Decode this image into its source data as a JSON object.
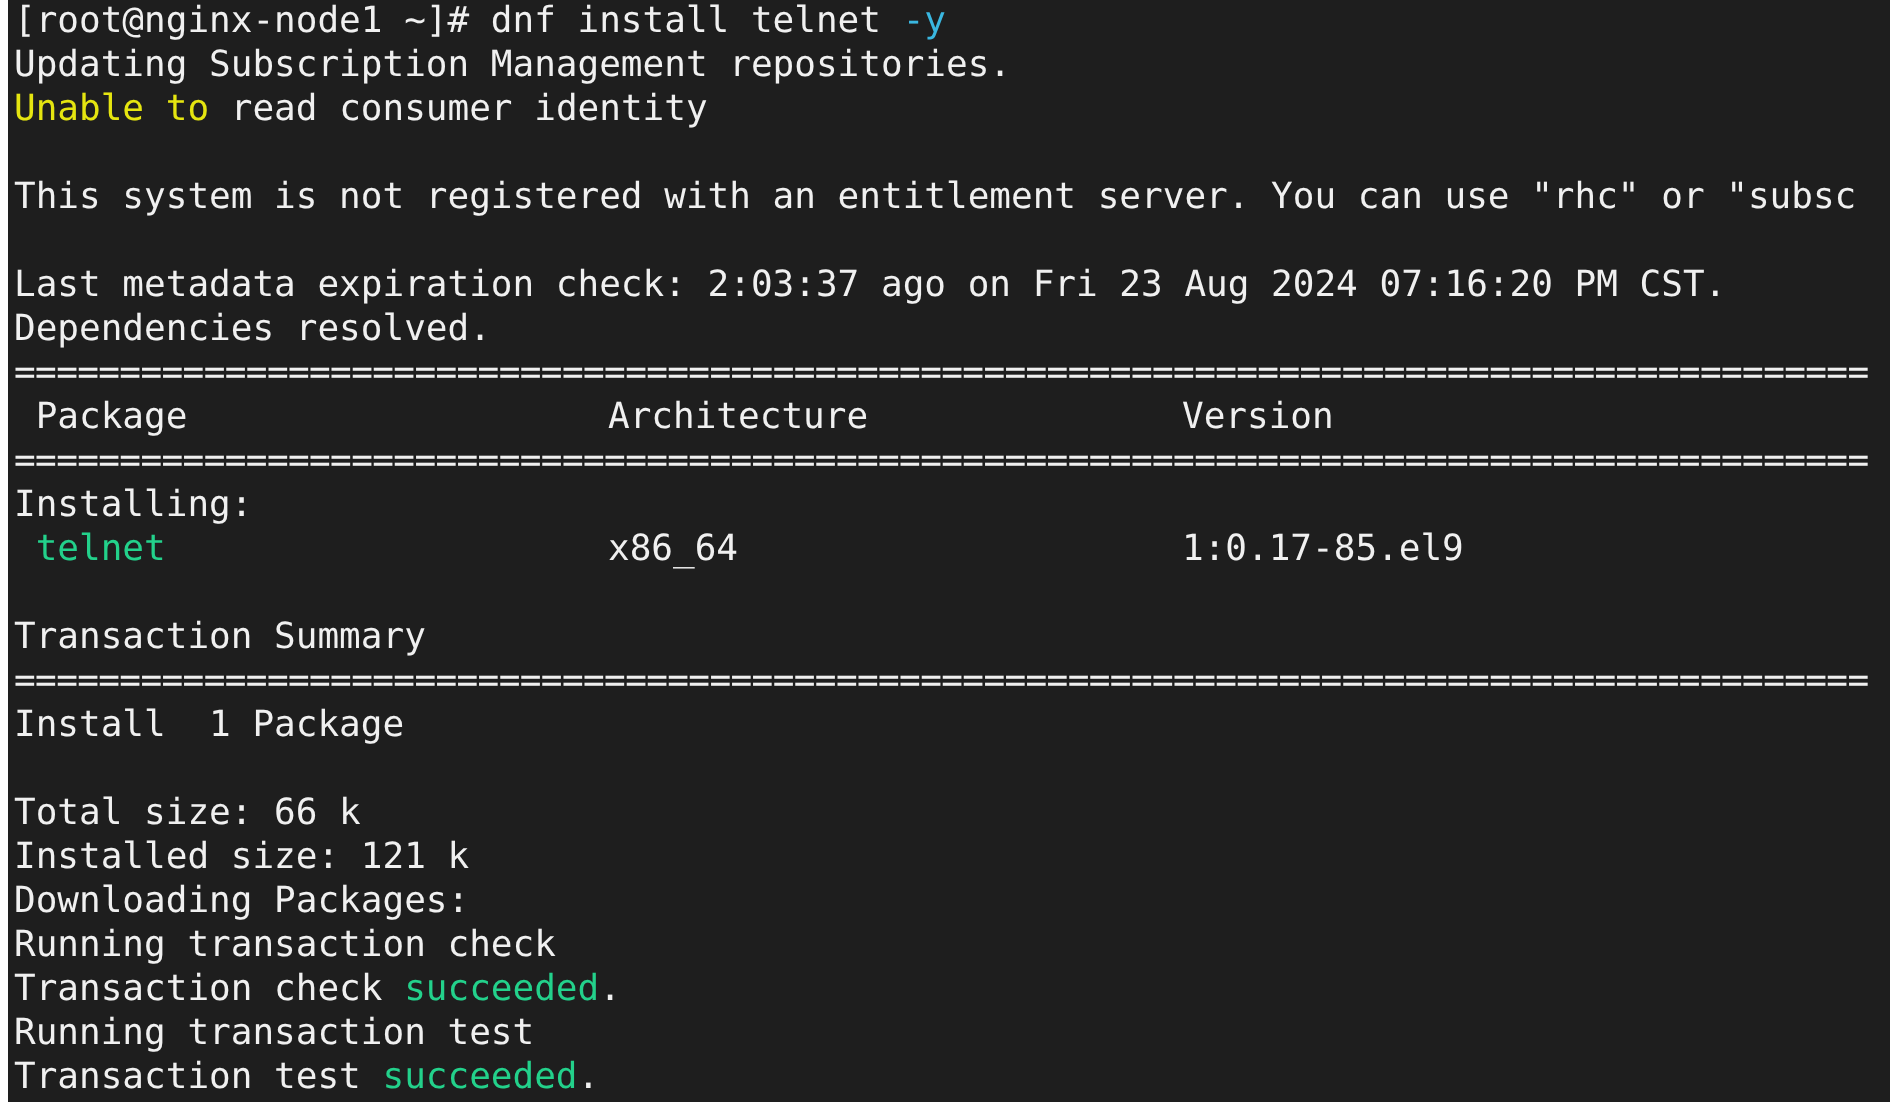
{
  "terminal": {
    "lines": [
      {
        "kind": "text",
        "segments": [
          {
            "text": "[root@nginx-node1 ~]# dnf install telnet ",
            "kind": "plain"
          },
          {
            "text": "-y",
            "kind": "option"
          }
        ]
      },
      {
        "kind": "text",
        "segments": [
          {
            "text": "Updating Subscription Management repositories.",
            "kind": "plain"
          }
        ]
      },
      {
        "kind": "text",
        "segments": [
          {
            "text": "Unable to",
            "kind": "warning"
          },
          {
            "text": " read consumer identity",
            "kind": "plain"
          }
        ]
      },
      {
        "kind": "blank"
      },
      {
        "kind": "text",
        "segments": [
          {
            "text": "This system is not registered with an entitlement server. You can use \"rhc\" or \"subsc",
            "kind": "plain"
          }
        ]
      },
      {
        "kind": "blank"
      },
      {
        "kind": "text",
        "segments": [
          {
            "text": "Last metadata expiration check: 2:03:37 ago on Fri 23 Aug 2024 07:16:20 PM CST.",
            "kind": "plain"
          }
        ]
      },
      {
        "kind": "text",
        "segments": [
          {
            "text": "Dependencies resolved.",
            "kind": "plain"
          }
        ]
      },
      {
        "kind": "rule",
        "text": "========================================================================================"
      },
      {
        "kind": "columns",
        "cells": [
          {
            "text": " Package",
            "kind": "plain"
          },
          {
            "text": "Architecture",
            "kind": "plain"
          },
          {
            "text": "Version",
            "kind": "plain"
          }
        ]
      },
      {
        "kind": "rule",
        "text": "========================================================================================"
      },
      {
        "kind": "text",
        "segments": [
          {
            "text": "Installing:",
            "kind": "plain"
          }
        ]
      },
      {
        "kind": "columns",
        "cells": [
          {
            "text": " telnet",
            "kind": "success"
          },
          {
            "text": "x86_64",
            "kind": "plain"
          },
          {
            "text": "1:0.17-85.el9",
            "kind": "plain"
          }
        ]
      },
      {
        "kind": "blank"
      },
      {
        "kind": "text",
        "segments": [
          {
            "text": "Transaction Summary",
            "kind": "plain"
          }
        ]
      },
      {
        "kind": "rule",
        "text": "========================================================================================"
      },
      {
        "kind": "text",
        "segments": [
          {
            "text": "Install  1 Package",
            "kind": "plain"
          }
        ]
      },
      {
        "kind": "blank"
      },
      {
        "kind": "text",
        "segments": [
          {
            "text": "Total size: 66 k",
            "kind": "plain"
          }
        ]
      },
      {
        "kind": "text",
        "segments": [
          {
            "text": "Installed size: 121 k",
            "kind": "plain"
          }
        ]
      },
      {
        "kind": "text",
        "segments": [
          {
            "text": "Downloading Packages:",
            "kind": "plain"
          }
        ]
      },
      {
        "kind": "text",
        "segments": [
          {
            "text": "Running transaction check",
            "kind": "plain"
          }
        ]
      },
      {
        "kind": "text",
        "segments": [
          {
            "text": "Transaction check ",
            "kind": "plain"
          },
          {
            "text": "succeeded",
            "kind": "success"
          },
          {
            "text": ".",
            "kind": "plain"
          }
        ]
      },
      {
        "kind": "text",
        "segments": [
          {
            "text": "Running transaction test",
            "kind": "plain"
          }
        ]
      },
      {
        "kind": "text",
        "segments": [
          {
            "text": "Transaction test ",
            "kind": "plain"
          },
          {
            "text": "succeeded",
            "kind": "success"
          },
          {
            "text": ".",
            "kind": "plain"
          }
        ]
      }
    ]
  }
}
